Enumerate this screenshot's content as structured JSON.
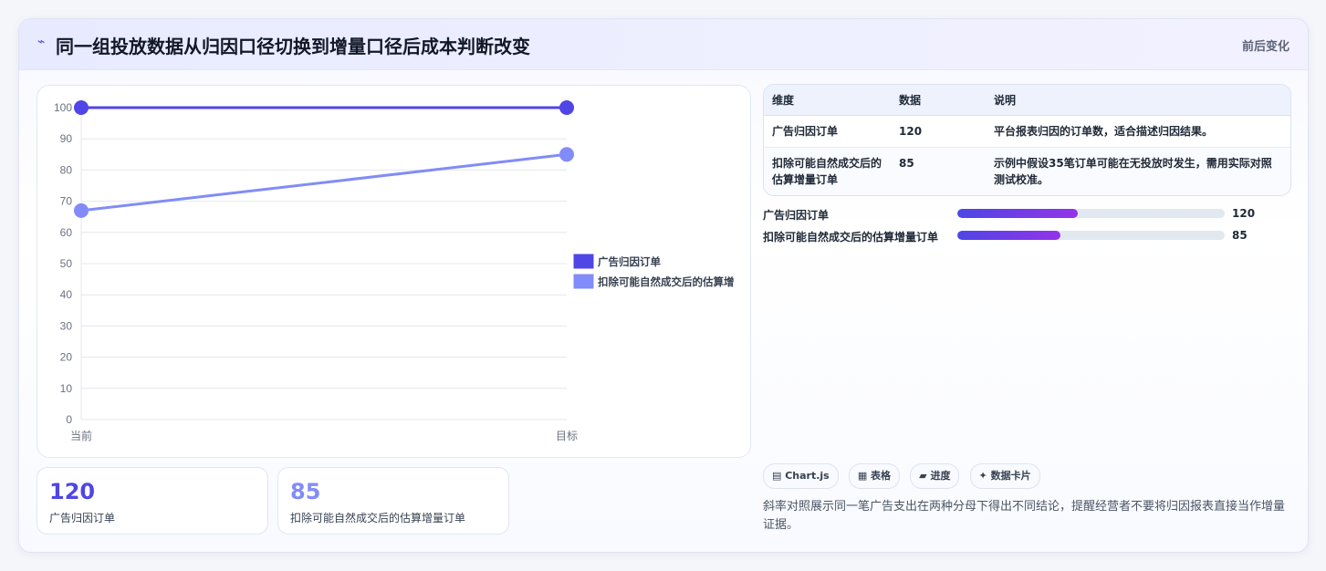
{
  "header": {
    "icon": "trend-icon",
    "title": "同一组投放数据从归因口径切换到增量口径后成本判断改变",
    "right_label": "前后变化"
  },
  "chart_data": {
    "type": "line",
    "categories": [
      "当前",
      "目标"
    ],
    "series": [
      {
        "name": "广告归因订单",
        "values": [
          100,
          100
        ],
        "color": "#4f46e5"
      },
      {
        "name": "扣除可能自然成交后的估算增",
        "values": [
          67,
          85
        ],
        "color": "#818cf8"
      }
    ],
    "ylim": [
      0,
      100
    ],
    "yticks": [
      0,
      10,
      20,
      30,
      40,
      50,
      60,
      70,
      80,
      90,
      100
    ],
    "legend": "right",
    "grid": true
  },
  "stats": [
    {
      "value": "120",
      "label": "广告归因订单",
      "color": "#4f46e5"
    },
    {
      "value": "85",
      "label": "扣除可能自然成交后的估算增量订单",
      "color": "#818cf8"
    }
  ],
  "table": {
    "headers": [
      "维度",
      "数据",
      "说明"
    ],
    "rows": [
      {
        "dim": "广告归因订单",
        "data": "120",
        "desc": "平台报表归因的订单数，适合描述归因结果。"
      },
      {
        "dim": "扣除可能自然成交后的估算增量订单",
        "data": "85",
        "desc": "示例中假设35笔订单可能在无投放时发生，需用实际对照测试校准。"
      }
    ]
  },
  "bars": [
    {
      "label": "广告归因订单",
      "value": "120",
      "fraction": 0.45
    },
    {
      "label": "扣除可能自然成交后的估算增量订单",
      "value": "85",
      "fraction": 0.385
    }
  ],
  "chips": [
    "▤ Chart.js",
    "▦ 表格",
    "▰ 进度",
    "✦ 数据卡片"
  ],
  "note": "斜率对照展示同一笔广告支出在两种分母下得出不同结论，提醒经营者不要将归因报表直接当作增量证据。"
}
